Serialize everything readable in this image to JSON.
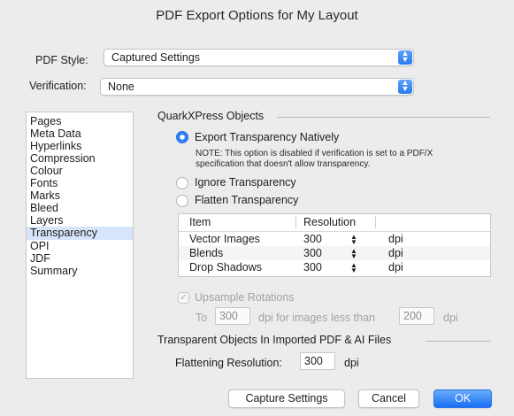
{
  "window": {
    "title": "PDF Export Options for My Layout"
  },
  "pdf_style": {
    "label": "PDF Style:",
    "value": "Captured Settings"
  },
  "verification": {
    "label": "Verification:",
    "value": "None"
  },
  "sidebar": {
    "items": [
      {
        "label": "Pages"
      },
      {
        "label": "Meta Data"
      },
      {
        "label": "Hyperlinks"
      },
      {
        "label": "Compression"
      },
      {
        "label": "Colour"
      },
      {
        "label": "Fonts"
      },
      {
        "label": "Marks"
      },
      {
        "label": "Bleed"
      },
      {
        "label": "Layers"
      },
      {
        "label": "Transparency"
      },
      {
        "label": "OPI"
      },
      {
        "label": "JDF"
      },
      {
        "label": "Summary"
      }
    ],
    "selected": "Transparency"
  },
  "quark_objects": {
    "header": "QuarkXPress Objects",
    "export_natively": "Export Transparency Natively",
    "note_line1": "NOTE: This option is disabled if verification is set to a PDF/X",
    "note_line2": "specification that doesn't allow transparency.",
    "ignore": "Ignore Transparency",
    "flatten": "Flatten Transparency",
    "selected_option": "Export Transparency Natively"
  },
  "table": {
    "headers": {
      "item": "Item",
      "resolution": "Resolution"
    },
    "rows": [
      {
        "item": "Vector Images",
        "resolution": "300",
        "unit": "dpi"
      },
      {
        "item": "Blends",
        "resolution": "300",
        "unit": "dpi"
      },
      {
        "item": "Drop Shadows",
        "resolution": "300",
        "unit": "dpi"
      }
    ]
  },
  "upsample": {
    "label": "Upsample Rotations",
    "checked": true,
    "disabled": true,
    "to_label": "To",
    "to_value": "300",
    "middle_label": "dpi for images less than",
    "less_than_value": "200",
    "unit": "dpi"
  },
  "imported": {
    "header": "Transparent Objects In Imported PDF & AI Files",
    "flattening_label": "Flattening Resolution:",
    "flattening_value": "300",
    "unit": "dpi"
  },
  "buttons": {
    "capture": "Capture Settings",
    "cancel": "Cancel",
    "ok": "OK"
  },
  "icons": {
    "popup_stepper": "up-down-chevron-icon",
    "table_stepper": "up-down-arrow-icon",
    "checkmark": "checkmark-icon"
  },
  "colors": {
    "accent": "#2f7ff5",
    "sidebar_selection": "#d6e5fa",
    "window_bg": "#ececec"
  }
}
